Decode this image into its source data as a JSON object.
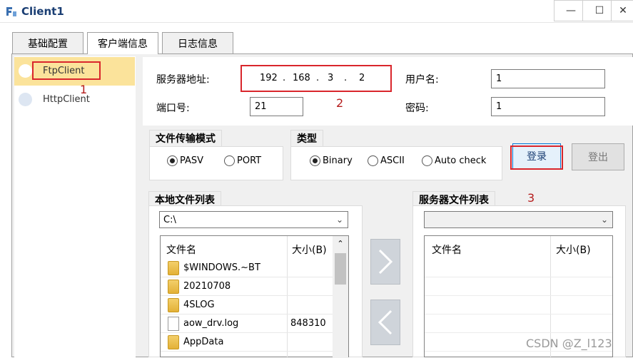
{
  "window": {
    "title": "Client1",
    "minimize_icon": "minimize-icon",
    "maximize_icon": "maximize-icon",
    "close_icon": "close-icon"
  },
  "tabs": [
    {
      "label": "基础配置"
    },
    {
      "label": "客户端信息"
    },
    {
      "label": "日志信息"
    }
  ],
  "client_list": [
    {
      "label": "FtpClient",
      "selected": true
    },
    {
      "label": "HttpClient",
      "selected": false
    }
  ],
  "server": {
    "address_label": "服务器地址:",
    "ip": [
      "192",
      ".",
      "168",
      ".",
      "3",
      ".",
      "2"
    ],
    "port_label": "端口号:",
    "port_value": "21",
    "username_label": "用户名:",
    "username_value": "1",
    "password_label": "密码:",
    "password_value": "1"
  },
  "transfer_mode": {
    "title": "文件传输模式",
    "options": [
      "PASV",
      "PORT"
    ],
    "selected": "PASV"
  },
  "type": {
    "title": "类型",
    "options": [
      "Binary",
      "ASCII",
      "Auto check"
    ],
    "selected": "Binary"
  },
  "buttons": {
    "login": "登录",
    "logout": "登出"
  },
  "local_files": {
    "title": "本地文件列表",
    "path": "C:\\",
    "col_name": "文件名",
    "col_size": "大小(B)",
    "rows": [
      {
        "name": "$WINDOWS.~BT",
        "size": "",
        "kind": "folder"
      },
      {
        "name": "20210708",
        "size": "",
        "kind": "folder"
      },
      {
        "name": "4SLOG",
        "size": "",
        "kind": "folder"
      },
      {
        "name": "aow_drv.log",
        "size": "848310",
        "kind": "file"
      },
      {
        "name": "AppData",
        "size": "",
        "kind": "folder"
      }
    ]
  },
  "server_files": {
    "title": "服务器文件列表",
    "path": "",
    "col_name": "文件名",
    "col_size": "大小(B)"
  },
  "annotations": [
    "1",
    "2",
    "3"
  ],
  "watermark": "CSDN @Z_l123"
}
